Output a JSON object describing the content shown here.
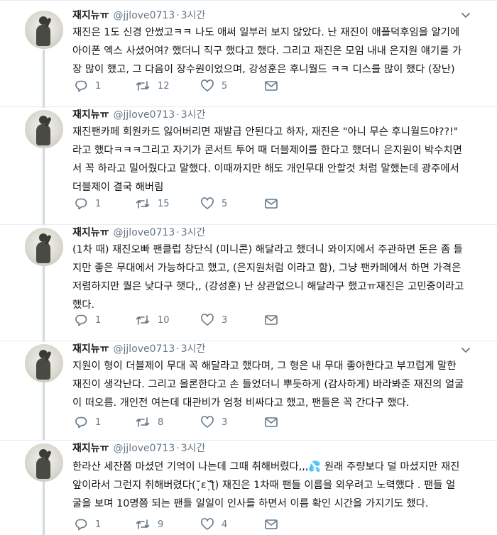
{
  "tweets": [
    {
      "name": "재지뉴ㅠ",
      "handle": "@jjlove0713",
      "dot": "·",
      "time": "3시간",
      "text": "재진은 1도 신경 안썼고ㅋㅋ 나도 애써 일부러 보지 않았다. 난 재진이 애플덕후임을 알기에\n아이폰 엑스 사셨어여? 했더니 직구 했다고 했다. 그리고 재진은 모임 내내 은지원 얘기를 가\n장 많이 했고, 그 다음이 장수원이었으며, 강성훈은 후니월드 ㅋㅋ 디스를 많이 했다 (장난)",
      "replies": "1",
      "retweets": "12",
      "likes": "5"
    },
    {
      "name": "재지뉴ㅠ",
      "handle": "@jjlove0713",
      "dot": "·",
      "time": "3시간",
      "text": "재진팬카페 회원카드 잃어버리면 재발급 안된다고 하자, 재진은 \"아니 무슨 후니월드야??!\"\n라고 했다ㅋㅋㅋ그리고 자기가 콘서트 투어 때 더블제이를 한다고 했더니 은지원이 박수치면\n서 꼭 하라고 밀어줬다고 말했다. 이때까지만 해도 개인무대 안할것 처럼 말했는데 광주에서\n더블제이 결국 해버림",
      "replies": "1",
      "retweets": "15",
      "likes": "5"
    },
    {
      "name": "재지뉴ㅠ",
      "handle": "@jjlove0713",
      "dot": "·",
      "time": "3시간",
      "text": "(1차 때) 재진오빠 팬클럽 창단식 (미니콘) 해달라고 했더니 와이지에서 주관하면 돈은 좀 들\n지만 좋은 무대에서 가능하다고 했고, (은지원처럼 이라고 함), 그냥 팬카페에서 하면 가격은\n저렴하지만 퀄은 낮다구 햇다,, (강성훈) 난 상관없으니 해달라구 했고ㅠ재진은 고민중이라고\n했다.",
      "replies": "1",
      "retweets": "10",
      "likes": "3"
    },
    {
      "name": "재지뉴ㅠ",
      "handle": "@jjlove0713",
      "dot": "·",
      "time": "3시간",
      "text": "지원이 형이 더블제이 무대 꼭 해달라고 했다며,  그 형은 내 무대 좋아한다고 부끄럽게 말한\n재진이 생각난다. 그리고 올론한다고 손 들었더니 뿌듯하게 (감사하게) 바라봐준 재진의 얼굴\n이 떠오름. 개인전 여는데 대관비가 엄청 비싸다고 했고, 팬들은 꼭 간다구 했다.",
      "replies": "1",
      "retweets": "8",
      "likes": "3"
    },
    {
      "name": "재지뉴ㅠ",
      "handle": "@jjlove0713",
      "dot": "·",
      "time": "3시간",
      "text": "한라산 세잔쯤 마셨던 기억이 나는데 그때 취해버렸다,,,💦 원래 주량보다 덜 마셨지만 재진\n앞이라서 그런지 취해버렸다(˘̩̩̩ε˘̩ƪ) 재진은 1차때 팬들 이름을 외우려고 노력했다 . 팬들 얼\n굴을 보며 10명쯤 되는 팬들 일일이 인사를 하면서 이름 확인 시간을 가지기도 했다.",
      "replies": "1",
      "retweets": "9",
      "likes": "4"
    }
  ]
}
